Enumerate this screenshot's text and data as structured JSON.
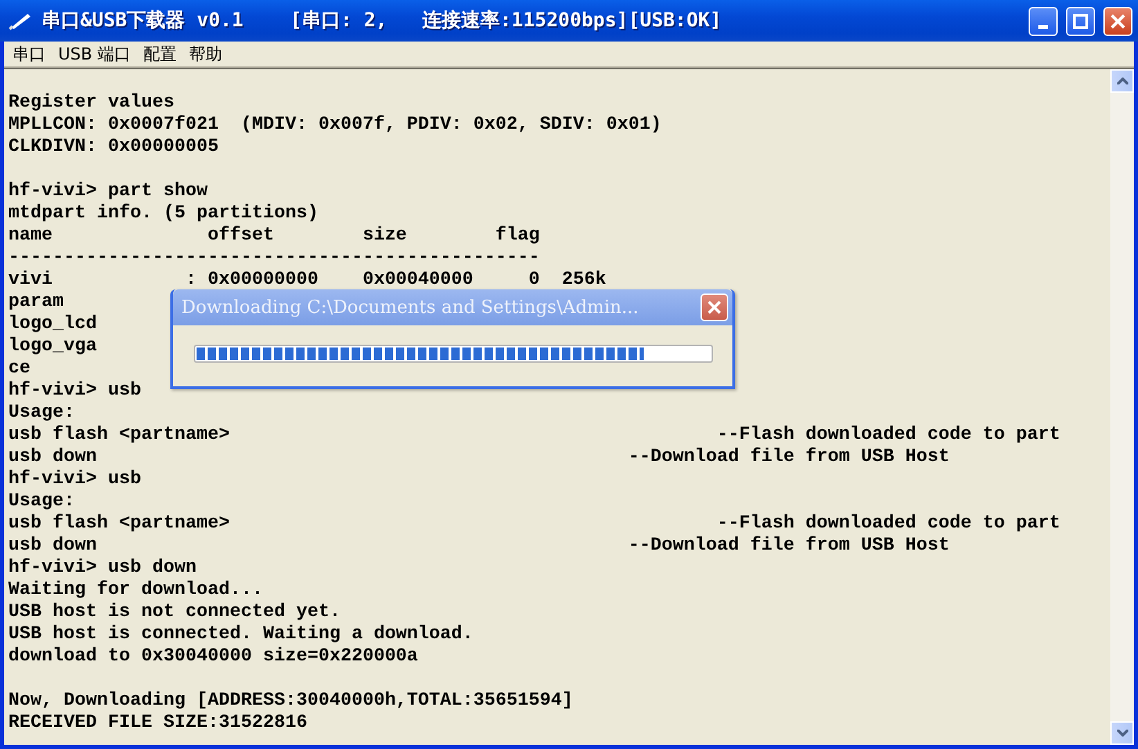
{
  "window": {
    "title": "串口&USB下载器 v0.1    [串口: 2,   连接速率:115200bps][USB:OK]"
  },
  "menu": [
    {
      "label": "串口"
    },
    {
      "label": "USB 端口"
    },
    {
      "label": "配置"
    },
    {
      "label": "帮助"
    }
  ],
  "console": {
    "blocks": [
      [
        "Register values",
        "MPLLCON: 0x0007f021  (MDIV: 0x007f, PDIV: 0x02, SDIV: 0x01)",
        "CLKDIVN: 0x00000005"
      ],
      [
        "hf-vivi> part show",
        "mtdpart info. (5 partitions)",
        "name              offset        size        flag",
        "------------------------------------------------",
        "vivi            : 0x00000000    0x00040000     0  256k",
        "param",
        "logo_lcd",
        "logo_vga",
        "ce",
        "hf-vivi> usb",
        "Usage:",
        "usb flash <partname>                                            --Flash downloaded code to part",
        "usb down                                                --Download file from USB Host",
        "hf-vivi> usb",
        "Usage:",
        "usb flash <partname>                                            --Flash downloaded code to part",
        "usb down                                                --Download file from USB Host",
        "hf-vivi> usb down",
        "Waiting for download...",
        "USB host is not connected yet.",
        "USB host is connected. Waiting a download.",
        "download to 0x30040000 size=0x220000a"
      ],
      [
        "Now, Downloading [ADDRESS:30040000h,TOTAL:35651594]",
        "RECEIVED FILE SIZE:31522816"
      ]
    ]
  },
  "dialog": {
    "title": "Downloading C:\\Documents and Settings\\Admin...",
    "progress": {
      "level": 0.87
    }
  }
}
